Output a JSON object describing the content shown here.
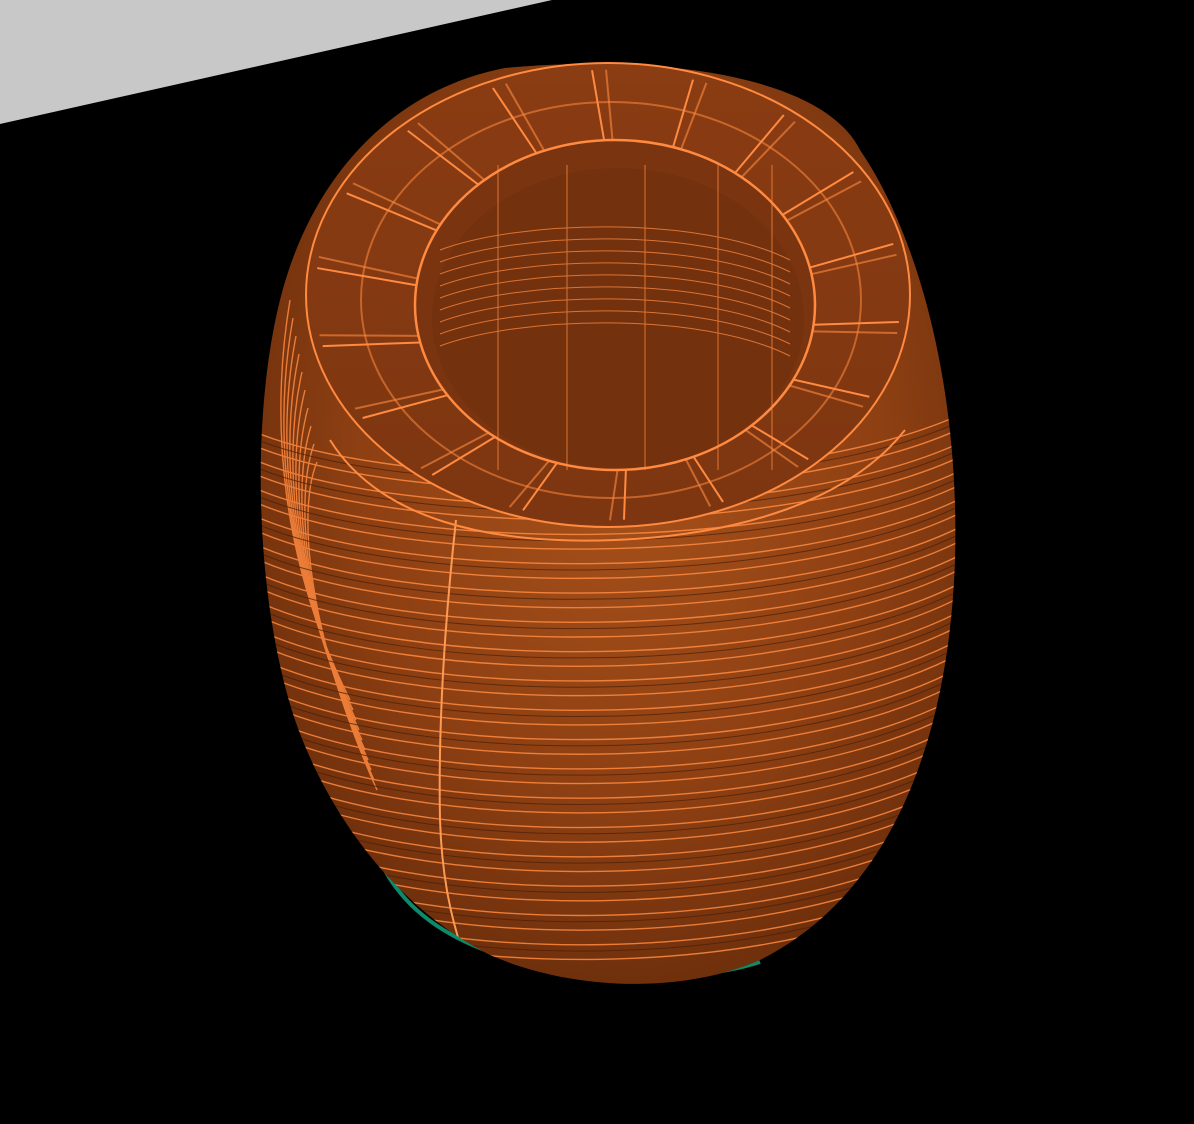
{
  "viewport": {
    "background": "#000000",
    "bed_color": "#c8c8c8",
    "wipe_ring_color": "#0d8a6a"
  },
  "model": {
    "shape": "barrel-vase",
    "body_color": "#8e3f12",
    "mid_color": "#a14b18",
    "shade_color": "#5a260a",
    "highlight_color": "#e07a3a",
    "line_color": "#ff8a40",
    "cavity_color": "#7a3510",
    "radial_rib_count": 18
  }
}
